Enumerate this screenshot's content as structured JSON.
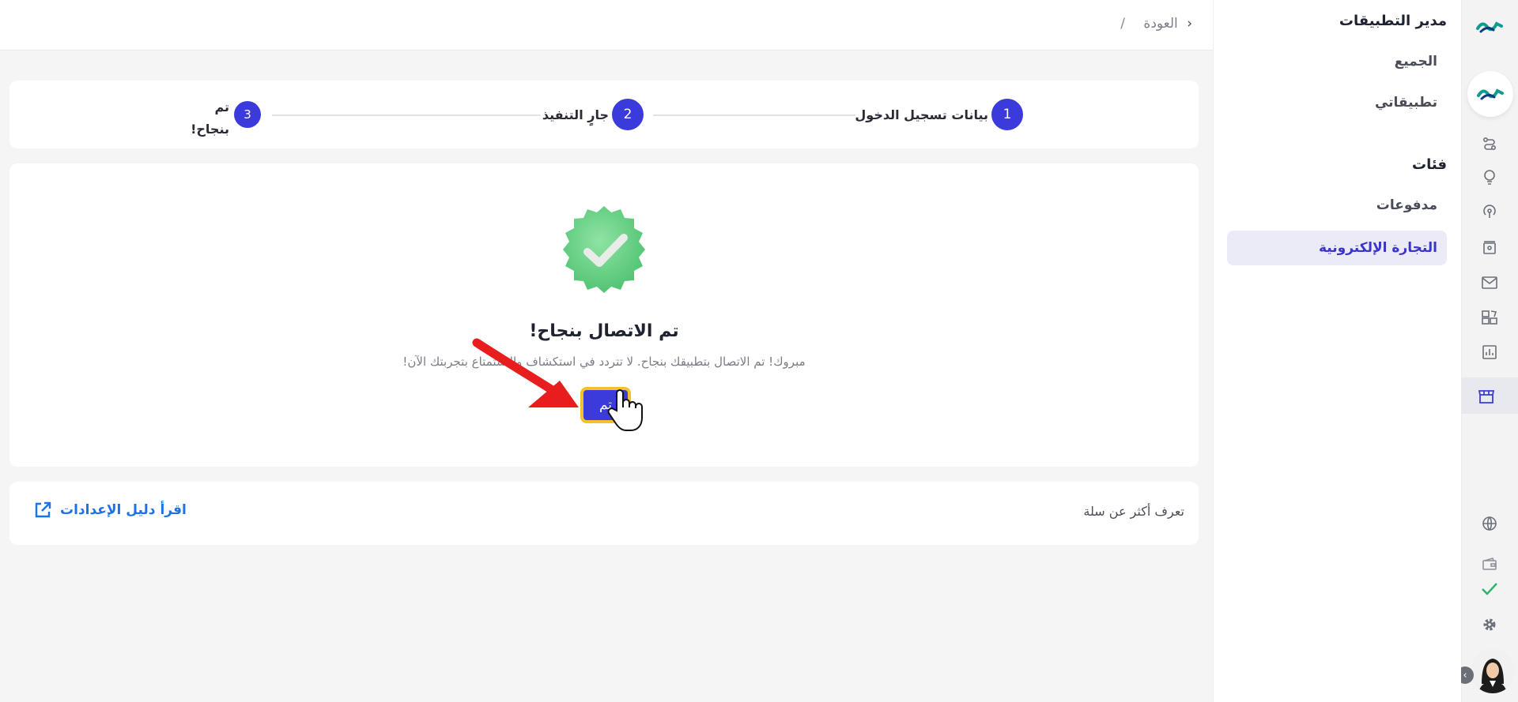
{
  "sidebar": {
    "title": "مدير التطبيقات",
    "items": [
      "الجميع",
      "تطبيقاتي"
    ],
    "section_title": "فئات",
    "categories": [
      "مدفوعات",
      "التجارة الإلكترونية"
    ],
    "active_category": "التجارة الإلكترونية"
  },
  "topbar": {
    "back_label": "العودة",
    "separator": "/"
  },
  "stepper": {
    "steps": [
      {
        "number": "1",
        "label": "بيانات تسجيل الدخول"
      },
      {
        "number": "2",
        "label": "جارٍ التنفيذ"
      },
      {
        "number": "3",
        "label_line1": "تم",
        "label_line2": "بنجاح!"
      }
    ]
  },
  "main": {
    "title": "تم الاتصال بنجاح!",
    "subtitle": "مبروك! تم الاتصال بتطبيقك بنجاح. لا تتردد في استكشاف والاستمتاع بتجربتك الآن!",
    "done_button": "تم"
  },
  "learn": {
    "text": "تعرف أكثر عن سلة",
    "guide_link": "اقرأ دليل الإعدادات"
  },
  "colors": {
    "primary": "#3b3bdc",
    "success": "#5fcf7f",
    "link": "#1a73e8",
    "highlight": "#f3c22a",
    "arrow": "#e81d1d"
  },
  "icons": [
    "logo-icon",
    "route-icon",
    "lightbulb-icon",
    "broadcast-icon",
    "store-profile-icon",
    "mail-icon",
    "apps-icon",
    "chart-icon",
    "storefront-icon",
    "globe-icon",
    "wallet-icon",
    "check-icon",
    "gear-icon"
  ]
}
